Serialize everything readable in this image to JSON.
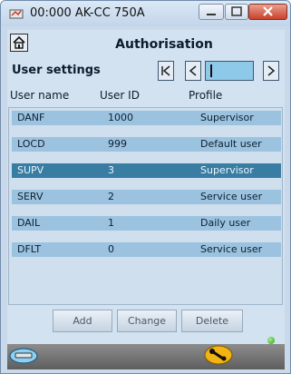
{
  "window": {
    "title": "00:000 AK-CC 750A"
  },
  "header": {
    "title": "Authorisation"
  },
  "section": {
    "subtitle": "User settings"
  },
  "table": {
    "columns": [
      "User name",
      "User ID",
      "Profile"
    ],
    "rows": [
      {
        "name": "DANF",
        "id": "1000",
        "profile": "Supervisor",
        "selected": false
      },
      {
        "name": "LOCD",
        "id": "999",
        "profile": "Default user",
        "selected": false
      },
      {
        "name": "SUPV",
        "id": "3",
        "profile": "Supervisor",
        "selected": true
      },
      {
        "name": "SERV",
        "id": "2",
        "profile": "Service user",
        "selected": false
      },
      {
        "name": "DAIL",
        "id": "1",
        "profile": "Daily user",
        "selected": false
      },
      {
        "name": "DFLT",
        "id": "0",
        "profile": "Service user",
        "selected": false
      }
    ]
  },
  "actions": {
    "add": "Add",
    "change": "Change",
    "delete": "Delete"
  },
  "colors": {
    "row": "#9bc3df",
    "row_selected": "#3a7da3",
    "status_ok": "#28a21a",
    "wrench": "#f2b413"
  }
}
